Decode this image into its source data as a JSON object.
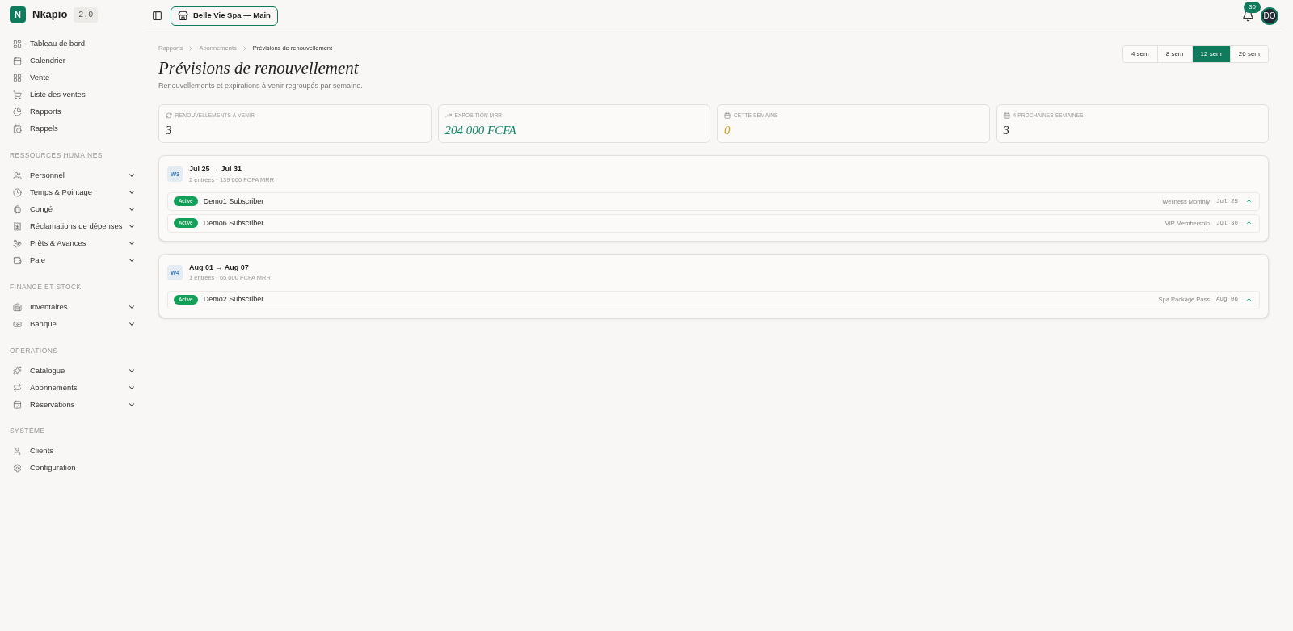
{
  "brand": {
    "logo": "N",
    "name": "Nkapio",
    "version": "2.0"
  },
  "sidebar": {
    "sections": [
      {
        "items": [
          {
            "label": "Tableau de bord",
            "kind": "link"
          },
          {
            "label": "Calendrier",
            "kind": "link"
          },
          {
            "label": "Vente",
            "kind": "link"
          },
          {
            "label": "Liste des ventes",
            "kind": "link"
          },
          {
            "label": "Rapports",
            "kind": "link"
          },
          {
            "label": "Rappels",
            "kind": "link"
          }
        ]
      },
      {
        "title": "RESSOURCES HUMAINES",
        "items": [
          {
            "label": "Personnel",
            "kind": "group"
          },
          {
            "label": "Temps & Pointage",
            "kind": "group"
          },
          {
            "label": "Congé",
            "kind": "group"
          },
          {
            "label": "Réclamations de dépenses",
            "kind": "group"
          },
          {
            "label": "Prêts & Avances",
            "kind": "group"
          },
          {
            "label": "Paie",
            "kind": "group"
          }
        ]
      },
      {
        "title": "FINANCE ET STOCK",
        "items": [
          {
            "label": "Inventaires",
            "kind": "group"
          },
          {
            "label": "Banque",
            "kind": "group"
          }
        ]
      },
      {
        "title": "OPÉRATIONS",
        "items": [
          {
            "label": "Catalogue",
            "kind": "group"
          },
          {
            "label": "Abonnements",
            "kind": "group"
          },
          {
            "label": "Réservations",
            "kind": "group"
          }
        ]
      },
      {
        "title": "SYSTÈME",
        "items": [
          {
            "label": "Clients",
            "kind": "link"
          },
          {
            "label": "Configuration",
            "kind": "link"
          }
        ]
      }
    ]
  },
  "topbar": {
    "store": "Belle Vie Spa — Main",
    "notifications": "30",
    "avatar": "DO"
  },
  "breadcrumb": [
    "Rapports",
    "Abonnements",
    "Prévisions de renouvellement"
  ],
  "title": "Prévisions de renouvellement",
  "subtitle": "Renouvellements et expirations à venir regroupés par semaine.",
  "ranges": [
    {
      "label": "4 sem",
      "selected": false
    },
    {
      "label": "8 sem",
      "selected": false
    },
    {
      "label": "12 sem",
      "selected": true
    },
    {
      "label": "26 sem",
      "selected": false
    }
  ],
  "stats": [
    {
      "label": "RENOUVELLEMENTS À VENIR",
      "value": "3",
      "kind": "neutral"
    },
    {
      "label": "EXPOSITION MRR",
      "value": "204 000 FCFA",
      "kind": "positive"
    },
    {
      "label": "CETTE SEMAINE",
      "value": "0",
      "kind": "warning"
    },
    {
      "label": "4 PROCHAINES SEMAINES",
      "value": "3",
      "kind": "neutral"
    }
  ],
  "weeks": [
    {
      "badge": "W3",
      "range": "Jul 25 → Jul 31",
      "summary": "2 entrées · 139 000 FCFA MRR",
      "entries": [
        {
          "status": "Active",
          "name": "Demo1 Subscriber",
          "plan": "Wellness Monthly",
          "date": "Jul 25"
        },
        {
          "status": "Active",
          "name": "Demo6 Subscriber",
          "plan": "VIP Membership",
          "date": "Jul 30"
        }
      ]
    },
    {
      "badge": "W4",
      "range": "Aug 01 → Aug 07",
      "summary": "1 entrées · 65 000 FCFA MRR",
      "entries": [
        {
          "status": "Active",
          "name": "Demo2 Subscriber",
          "plan": "Spa Package Pass",
          "date": "Aug 06"
        }
      ]
    }
  ]
}
